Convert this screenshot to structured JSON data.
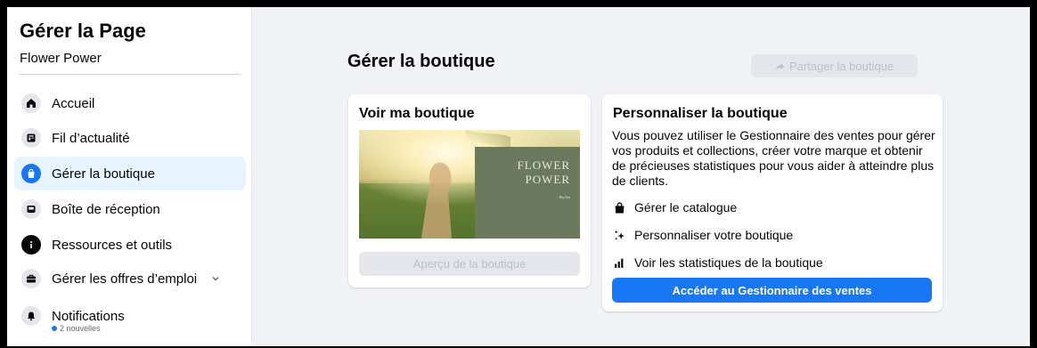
{
  "sidebar": {
    "title": "Gérer la Page",
    "page_name": "Flower Power",
    "items": [
      {
        "label": "Accueil"
      },
      {
        "label": "Fil d’actualité"
      },
      {
        "label": "Gérer la boutique"
      },
      {
        "label": "Boîte de réception"
      },
      {
        "label": "Ressources et outils"
      },
      {
        "label": "Gérer les offres d’emploi"
      },
      {
        "label": "Notifications",
        "badge": "2 nouvelles"
      }
    ]
  },
  "main": {
    "title": "Gérer la boutique",
    "share_label": "Partager la boutique",
    "shop_card": {
      "title": "Voir ma boutique",
      "logo_line1": "FLOWER",
      "logo_line2": "POWER",
      "logo_tagline": "Hip Era",
      "preview_label": "Aperçu de la boutique"
    },
    "custom_card": {
      "title": "Personnaliser la boutique",
      "description": "Vous pouvez utiliser le Gestionnaire des ventes pour gérer vos produits et collections, créer votre marque et obtenir de précieuses statistiques pour vous aider à atteindre plus de clients.",
      "features": [
        {
          "label": "Gérer le catalogue",
          "icon": "shopping-bag-icon"
        },
        {
          "label": "Personnaliser votre boutique",
          "icon": "sparkle-icon"
        },
        {
          "label": "Voir les statistiques de la boutique",
          "icon": "bar-chart-icon"
        }
      ],
      "cta_label": "Accéder au Gestionnaire des ventes"
    }
  },
  "colors": {
    "accent": "#1877f2",
    "active_bg": "#e7f3ff",
    "page_bg": "#f0f2f5",
    "logo_panel": "#6b7a5f"
  }
}
